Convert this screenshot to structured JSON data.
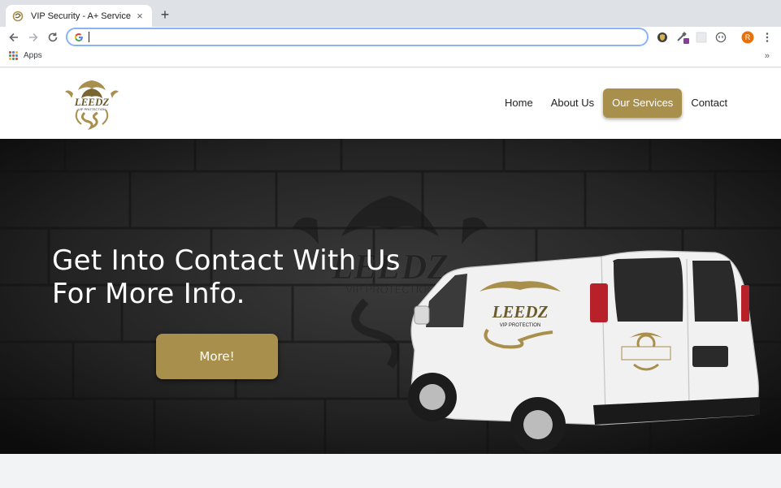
{
  "browser": {
    "tab_title": "VIP Security - A+ Service",
    "tab_close": "×",
    "new_tab": "+",
    "address_value": "",
    "profile_initial": "R",
    "bookmarks": {
      "apps_label": "Apps",
      "overflow": "»"
    }
  },
  "site": {
    "logo_text": "LEEDZ",
    "logo_subtext": "VIP PROTECTION",
    "nav": [
      {
        "label": "Home"
      },
      {
        "label": "About Us"
      },
      {
        "label": "Our Services"
      },
      {
        "label": "Contact"
      }
    ],
    "hero": {
      "headline_line1": "Get Into Contact With Us",
      "headline_line2": "For More Info.",
      "button_label": "More!",
      "watermark_text": "LEEDZ",
      "watermark_subtext": "VIP PROTECTION",
      "van_logo_text": "LEEDZ",
      "van_logo_subtext": "VIP PROTECTION"
    }
  },
  "colors": {
    "accent_gold": "#a98f4c",
    "chrome_tabstrip": "#dee1e6",
    "focus_ring": "#8ab4f8",
    "profile": "#e8710a"
  },
  "icons": {
    "back": "back-arrow-icon",
    "forward": "forward-arrow-icon",
    "reload": "reload-icon",
    "google": "google-g-icon",
    "menu": "kebab-menu-icon"
  }
}
